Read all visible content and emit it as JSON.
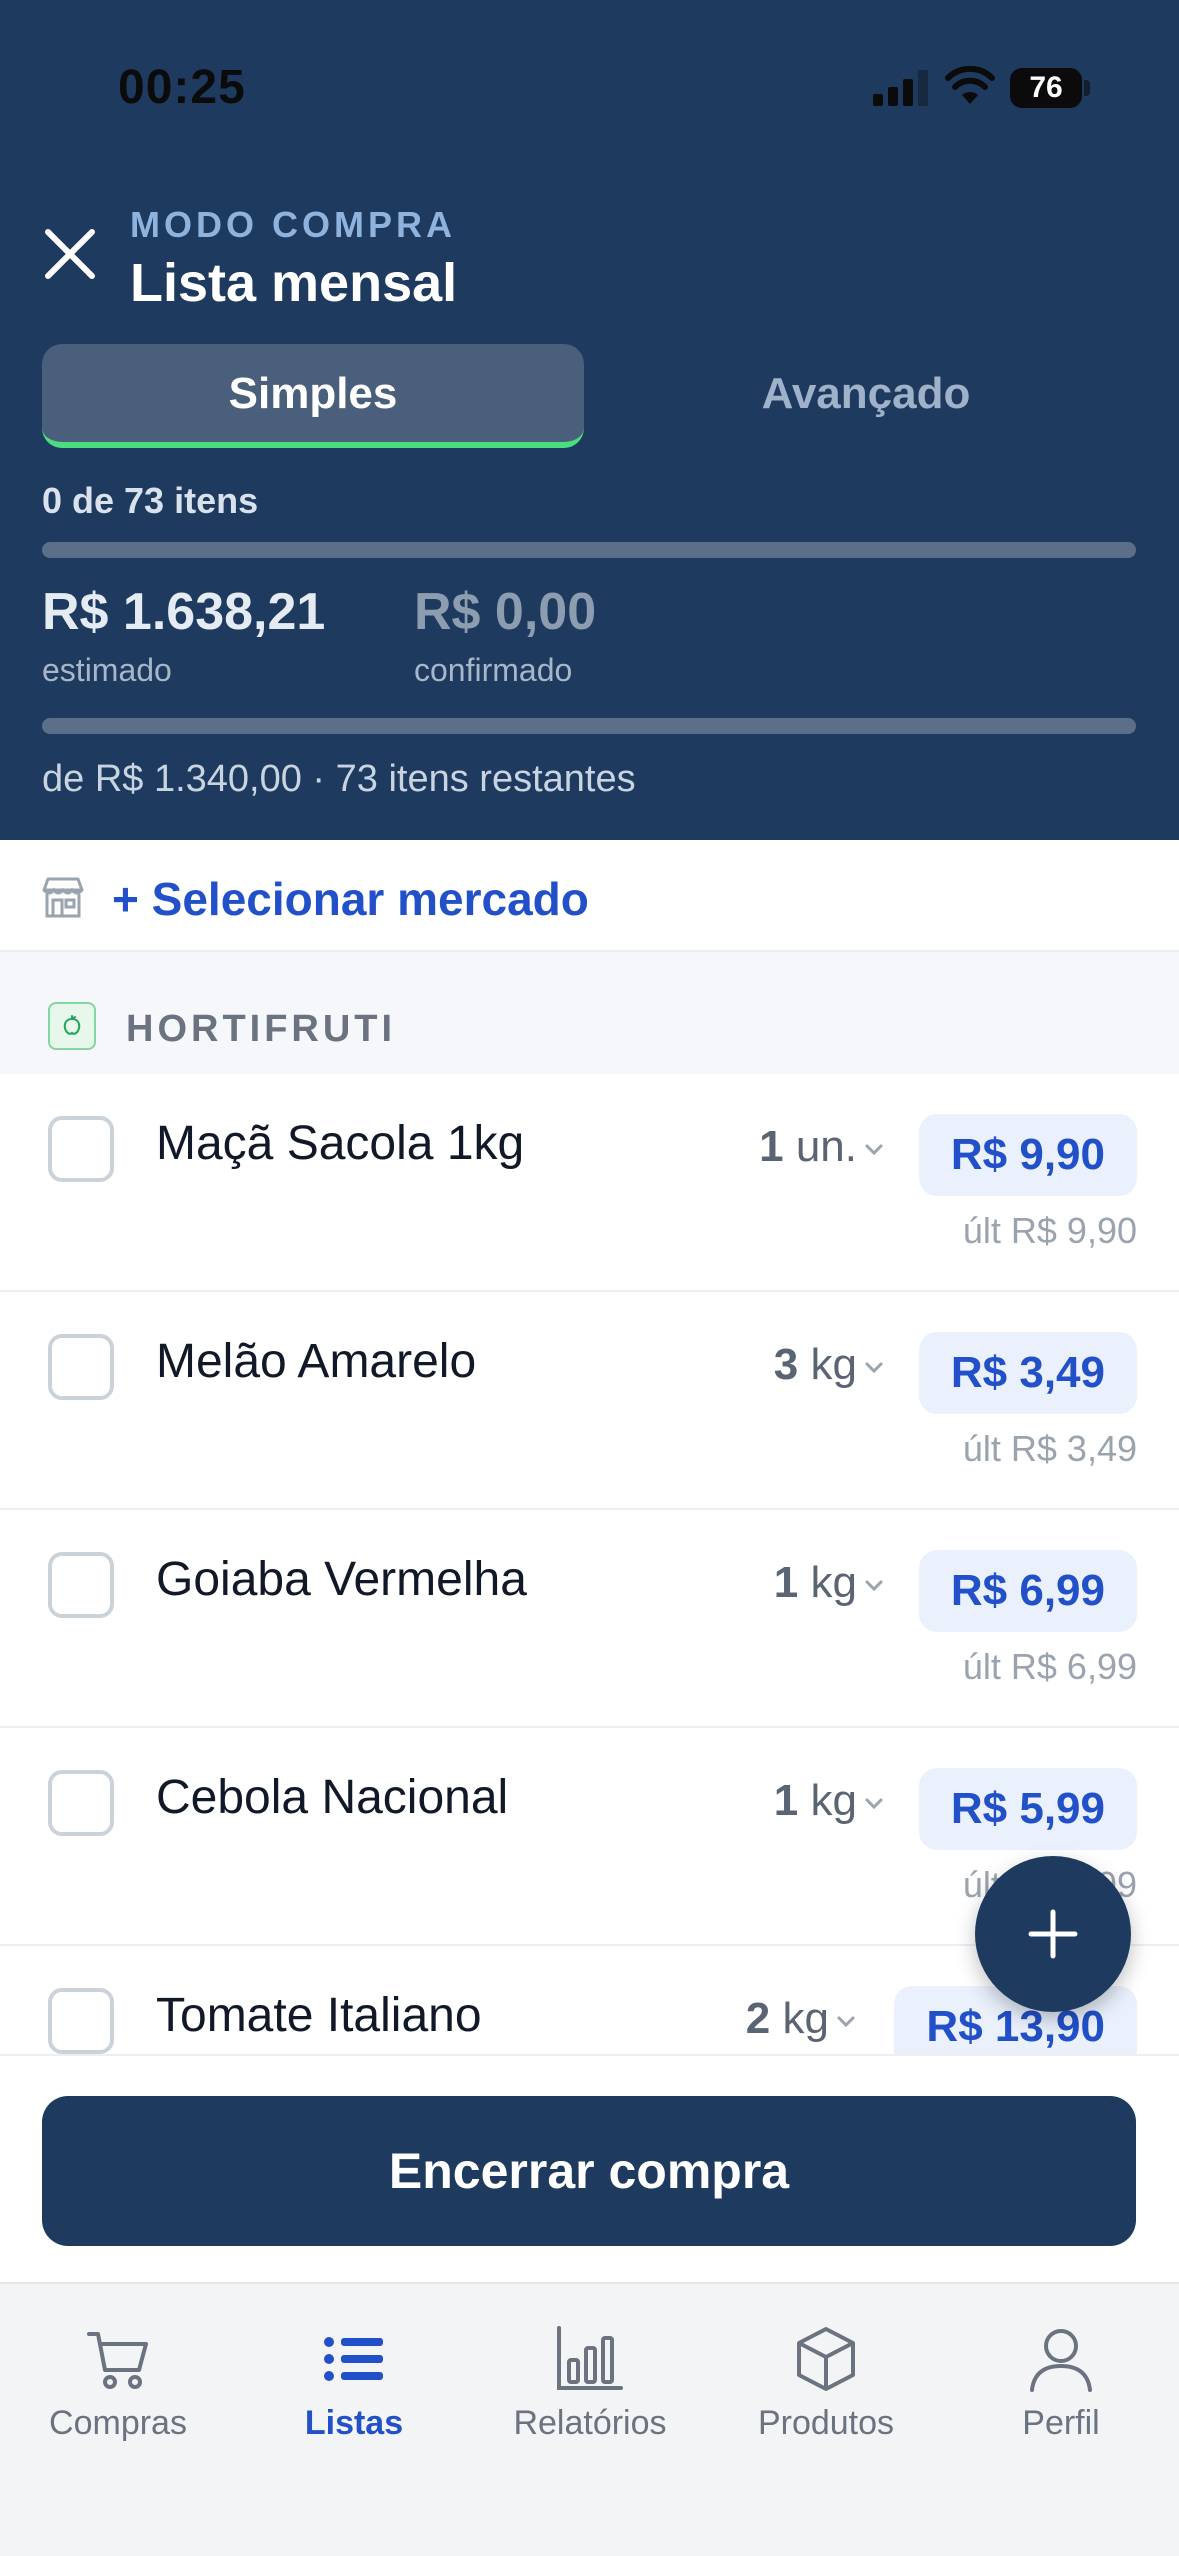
{
  "status_bar": {
    "time": "00:25",
    "battery": "76"
  },
  "header": {
    "mode_label": "MODO COMPRA",
    "title": "Lista mensal",
    "tabs": {
      "simple": "Simples",
      "advanced": "Avançado"
    },
    "item_count": "0 de 73 itens",
    "items_progress": 0,
    "estimated_value": "R$ 1.638,21",
    "estimated_label": "estimado",
    "confirmed_value": "R$ 0,00",
    "confirmed_label": "confirmado",
    "budget_progress": 0,
    "budget_text": "de R$ 1.340,00 · 73 itens restantes"
  },
  "store": {
    "select_label": "+ Selecionar mercado"
  },
  "section": {
    "title": "HORTIFRUTI"
  },
  "items": [
    {
      "name": "Maçã Sacola 1kg",
      "qty_num": "1",
      "qty_unit": "un.",
      "price": "R$ 9,90",
      "last": "últ R$ 9,90"
    },
    {
      "name": "Melão Amarelo",
      "qty_num": "3",
      "qty_unit": "kg",
      "price": "R$ 3,49",
      "last": "últ R$ 3,49"
    },
    {
      "name": "Goiaba Vermelha",
      "qty_num": "1",
      "qty_unit": "kg",
      "price": "R$ 6,99",
      "last": "últ R$ 6,99"
    },
    {
      "name": "Cebola Nacional",
      "qty_num": "1",
      "qty_unit": "kg",
      "price": "R$ 5,99",
      "last": "últ R$ 5,99"
    },
    {
      "name": "Tomate Italiano",
      "qty_num": "2",
      "qty_unit": "kg",
      "price": "R$ 13,90",
      "last": ""
    }
  ],
  "actions": {
    "end_purchase": "Encerrar compra"
  },
  "tabbar": {
    "items": [
      {
        "label": "Compras",
        "icon": "cart-icon"
      },
      {
        "label": "Listas",
        "icon": "list-icon"
      },
      {
        "label": "Relatórios",
        "icon": "bar-chart-icon"
      },
      {
        "label": "Produtos",
        "icon": "box-icon"
      },
      {
        "label": "Perfil",
        "icon": "user-icon"
      }
    ],
    "active": "Listas"
  },
  "colors": {
    "header": "#1e3a5f",
    "accent": "#2150c9",
    "progress": "#4ade80",
    "price_bg": "#eaf1fd"
  }
}
